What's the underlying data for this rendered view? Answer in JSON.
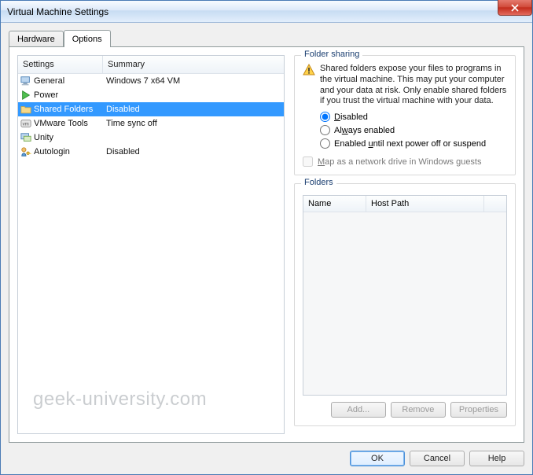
{
  "window": {
    "title": "Virtual Machine Settings"
  },
  "tabs": {
    "hardware": "Hardware",
    "options": "Options"
  },
  "leftHeaders": {
    "settings": "Settings",
    "summary": "Summary"
  },
  "rows": [
    {
      "name": "General",
      "summary": "Windows 7 x64 VM"
    },
    {
      "name": "Power",
      "summary": ""
    },
    {
      "name": "Shared Folders",
      "summary": "Disabled"
    },
    {
      "name": "VMware Tools",
      "summary": "Time sync off"
    },
    {
      "name": "Unity",
      "summary": ""
    },
    {
      "name": "Autologin",
      "summary": "Disabled"
    }
  ],
  "sharing": {
    "title": "Folder sharing",
    "warning": "Shared folders expose your files to programs in the virtual machine. This may put your computer and your data at risk. Only enable shared folders if you trust the virtual machine with your data.",
    "radio1_pre": "",
    "radio1_u": "D",
    "radio1_post": "isabled",
    "radio2_pre": "Al",
    "radio2_u": "w",
    "radio2_post": "ays enabled",
    "radio3_pre": "Enabled ",
    "radio3_u": "u",
    "radio3_post": "ntil next power off or suspend",
    "mapdrive_u": "M",
    "mapdrive_post": "ap as a network drive in Windows guests"
  },
  "folders": {
    "title": "Folders",
    "colName": "Name",
    "colHost": "Host Path",
    "add": "Add...",
    "remove": "Remove",
    "props": "Properties"
  },
  "footer": {
    "ok": "OK",
    "cancel": "Cancel",
    "help": "Help"
  },
  "watermark": "geek-university.com"
}
